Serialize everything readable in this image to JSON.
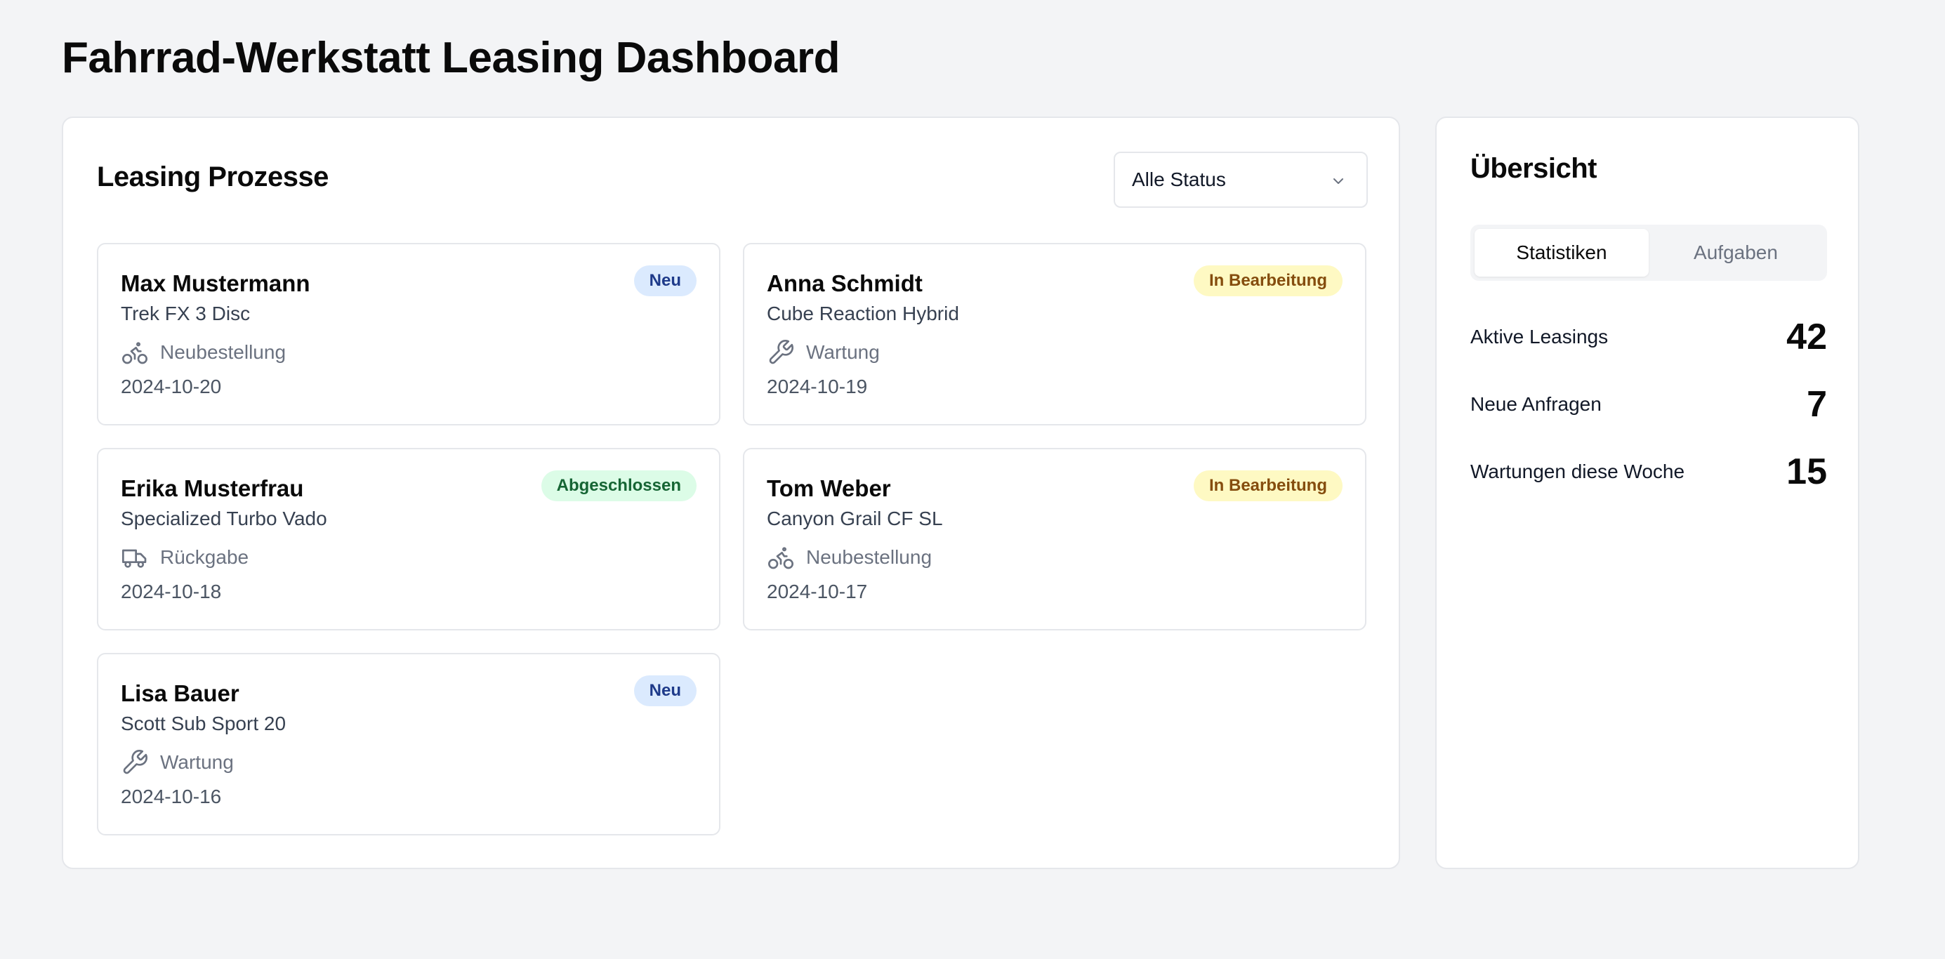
{
  "page": {
    "title": "Fahrrad-Werkstatt Leasing Dashboard"
  },
  "leasing": {
    "heading": "Leasing Prozesse",
    "filter": {
      "selected": "Alle Status"
    },
    "cards": [
      {
        "name": "Max Mustermann",
        "model": "Trek FX 3 Disc",
        "type": "Neubestellung",
        "type_icon": "bike-icon",
        "date": "2024-10-20",
        "status": "Neu"
      },
      {
        "name": "Anna Schmidt",
        "model": "Cube Reaction Hybrid",
        "type": "Wartung",
        "type_icon": "wrench-icon",
        "date": "2024-10-19",
        "status": "In Bearbeitung"
      },
      {
        "name": "Erika Musterfrau",
        "model": "Specialized Turbo Vado",
        "type": "Rückgabe",
        "type_icon": "truck-icon",
        "date": "2024-10-18",
        "status": "Abgeschlossen"
      },
      {
        "name": "Tom Weber",
        "model": "Canyon Grail CF SL",
        "type": "Neubestellung",
        "type_icon": "bike-icon",
        "date": "2024-10-17",
        "status": "In Bearbeitung"
      },
      {
        "name": "Lisa Bauer",
        "model": "Scott Sub Sport 20",
        "type": "Wartung",
        "type_icon": "wrench-icon",
        "date": "2024-10-16",
        "status": "Neu"
      }
    ]
  },
  "overview": {
    "heading": "Übersicht",
    "tabs": [
      {
        "label": "Statistiken",
        "active": true
      },
      {
        "label": "Aufgaben",
        "active": false
      }
    ],
    "stats": [
      {
        "label": "Aktive Leasings",
        "value": "42"
      },
      {
        "label": "Neue Anfragen",
        "value": "7"
      },
      {
        "label": "Wartungen diese Woche",
        "value": "15"
      }
    ]
  },
  "colors": {
    "badge_new_bg": "#dbeafe",
    "badge_new_fg": "#1e3a8a",
    "badge_progress_bg": "#fef9c3",
    "badge_progress_fg": "#854d0e",
    "badge_done_bg": "#dcfce7",
    "badge_done_fg": "#166534"
  }
}
